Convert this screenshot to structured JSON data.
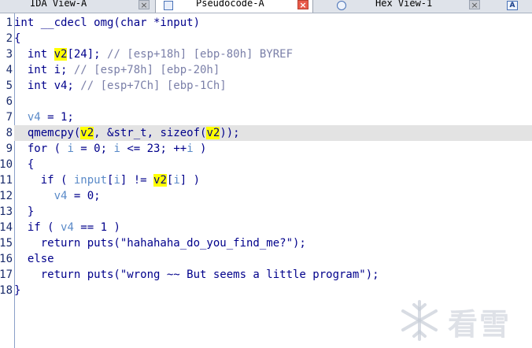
{
  "tabs": [
    {
      "label": "IDA View-A",
      "close": "×",
      "active": false
    },
    {
      "label": "Pseudocode-A",
      "close": "×",
      "active": true
    },
    {
      "label": "Hex View-1",
      "close": "×",
      "active": false
    },
    {
      "label": "A",
      "active": false
    }
  ],
  "code": [
    {
      "n": "1"
    },
    {
      "n": "2"
    },
    {
      "n": "3"
    },
    {
      "n": "4"
    },
    {
      "n": "5"
    },
    {
      "n": "6"
    },
    {
      "n": "7"
    },
    {
      "n": "8"
    },
    {
      "n": "9"
    },
    {
      "n": "10"
    },
    {
      "n": "11"
    },
    {
      "n": "12"
    },
    {
      "n": "13"
    },
    {
      "n": "14"
    },
    {
      "n": "15"
    },
    {
      "n": "16"
    },
    {
      "n": "17"
    },
    {
      "n": "18"
    }
  ],
  "tokens": {
    "l1": "int __cdecl omg(char *input)",
    "l2": "{",
    "l3a": "  int ",
    "l3b": "v2",
    "l3c": "[24]; ",
    "l3d": "// [esp+18h] [ebp-80h] BYREF",
    "l4a": "  int i; ",
    "l4b": "// [esp+78h] [ebp-20h]",
    "l5a": "  int v4; ",
    "l5b": "// [esp+7Ch] [ebp-1Ch]",
    "l7a": "  ",
    "l7b": "v4",
    "l7c": " = 1;",
    "l8a": "  qmemcpy(",
    "l8b": "v2",
    "l8c": ", &str_t, sizeof(",
    "l8d": "v2",
    "l8e": "));",
    "l9a": "  for ( ",
    "l9b": "i",
    "l9c": " = 0; ",
    "l9d": "i",
    "l9e": " <= 23; ++",
    "l9f": "i",
    "l9g": " )",
    "l10": "  {",
    "l11a": "    if ( ",
    "l11b": "input",
    "l11c": "[",
    "l11d": "i",
    "l11e": "] != ",
    "l11f": "v2",
    "l11g": "[",
    "l11h": "i",
    "l11i": "] )",
    "l12a": "      ",
    "l12b": "v4",
    "l12c": " = 0;",
    "l13": "  }",
    "l14a": "  if ( ",
    "l14b": "v4",
    "l14c": " == 1 )",
    "l15": "    return puts(\"hahahaha_do_you_find_me?\");",
    "l16": "  else",
    "l17": "    return puts(\"wrong ~~ But seems a little program\");",
    "l18": "}"
  },
  "watermark": {
    "text": "看雪",
    "icon": "snowflake-icon"
  },
  "colors": {
    "highlight": "#ffff00",
    "current_line": "#e3e3e3",
    "comment": "#7a7fa8",
    "variable": "#5a8ac8",
    "code": "#00008b"
  }
}
